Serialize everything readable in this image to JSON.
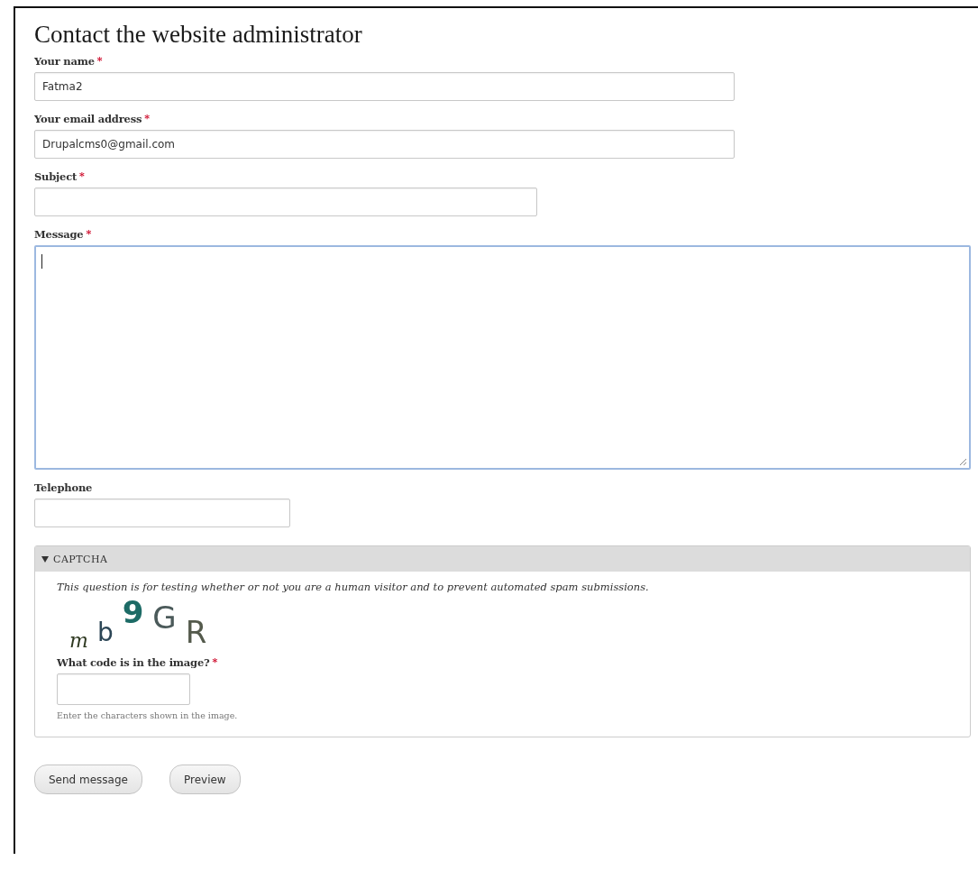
{
  "title": "Contact the website administrator",
  "fields": [
    {
      "kind": "text",
      "label": "Your name",
      "required_mark": "*",
      "value": "Fatma2"
    },
    {
      "kind": "text",
      "label": "Your email address",
      "required_mark": "*",
      "value": "Drupalcms0@gmail.com"
    },
    {
      "kind": "text",
      "label": "Subject",
      "required_mark": "*"
    },
    {
      "kind": "textarea",
      "label": "Message",
      "required_mark": "*",
      "focused": true
    },
    {
      "kind": "text",
      "label": "Telephone"
    }
  ],
  "captcha": {
    "legend": "CAPTCHA",
    "expanded": true,
    "description": "This question is for testing whether or not you are a human visitor and to prevent automated spam submissions.",
    "image_glyphs": [
      {
        "text": "m",
        "color": "#2f3a22"
      },
      {
        "text": "b",
        "color": "#2c4656"
      },
      {
        "text": "9",
        "color": "#1d6b66"
      },
      {
        "text": "G",
        "color": "#4b5a5a"
      },
      {
        "text": "R",
        "color": "#545a4c"
      }
    ],
    "answer": {
      "label": "What code is in the image?",
      "required_mark": "*",
      "help": "Enter the characters shown in the image."
    }
  },
  "buttons": [
    "Send message",
    "Preview"
  ]
}
